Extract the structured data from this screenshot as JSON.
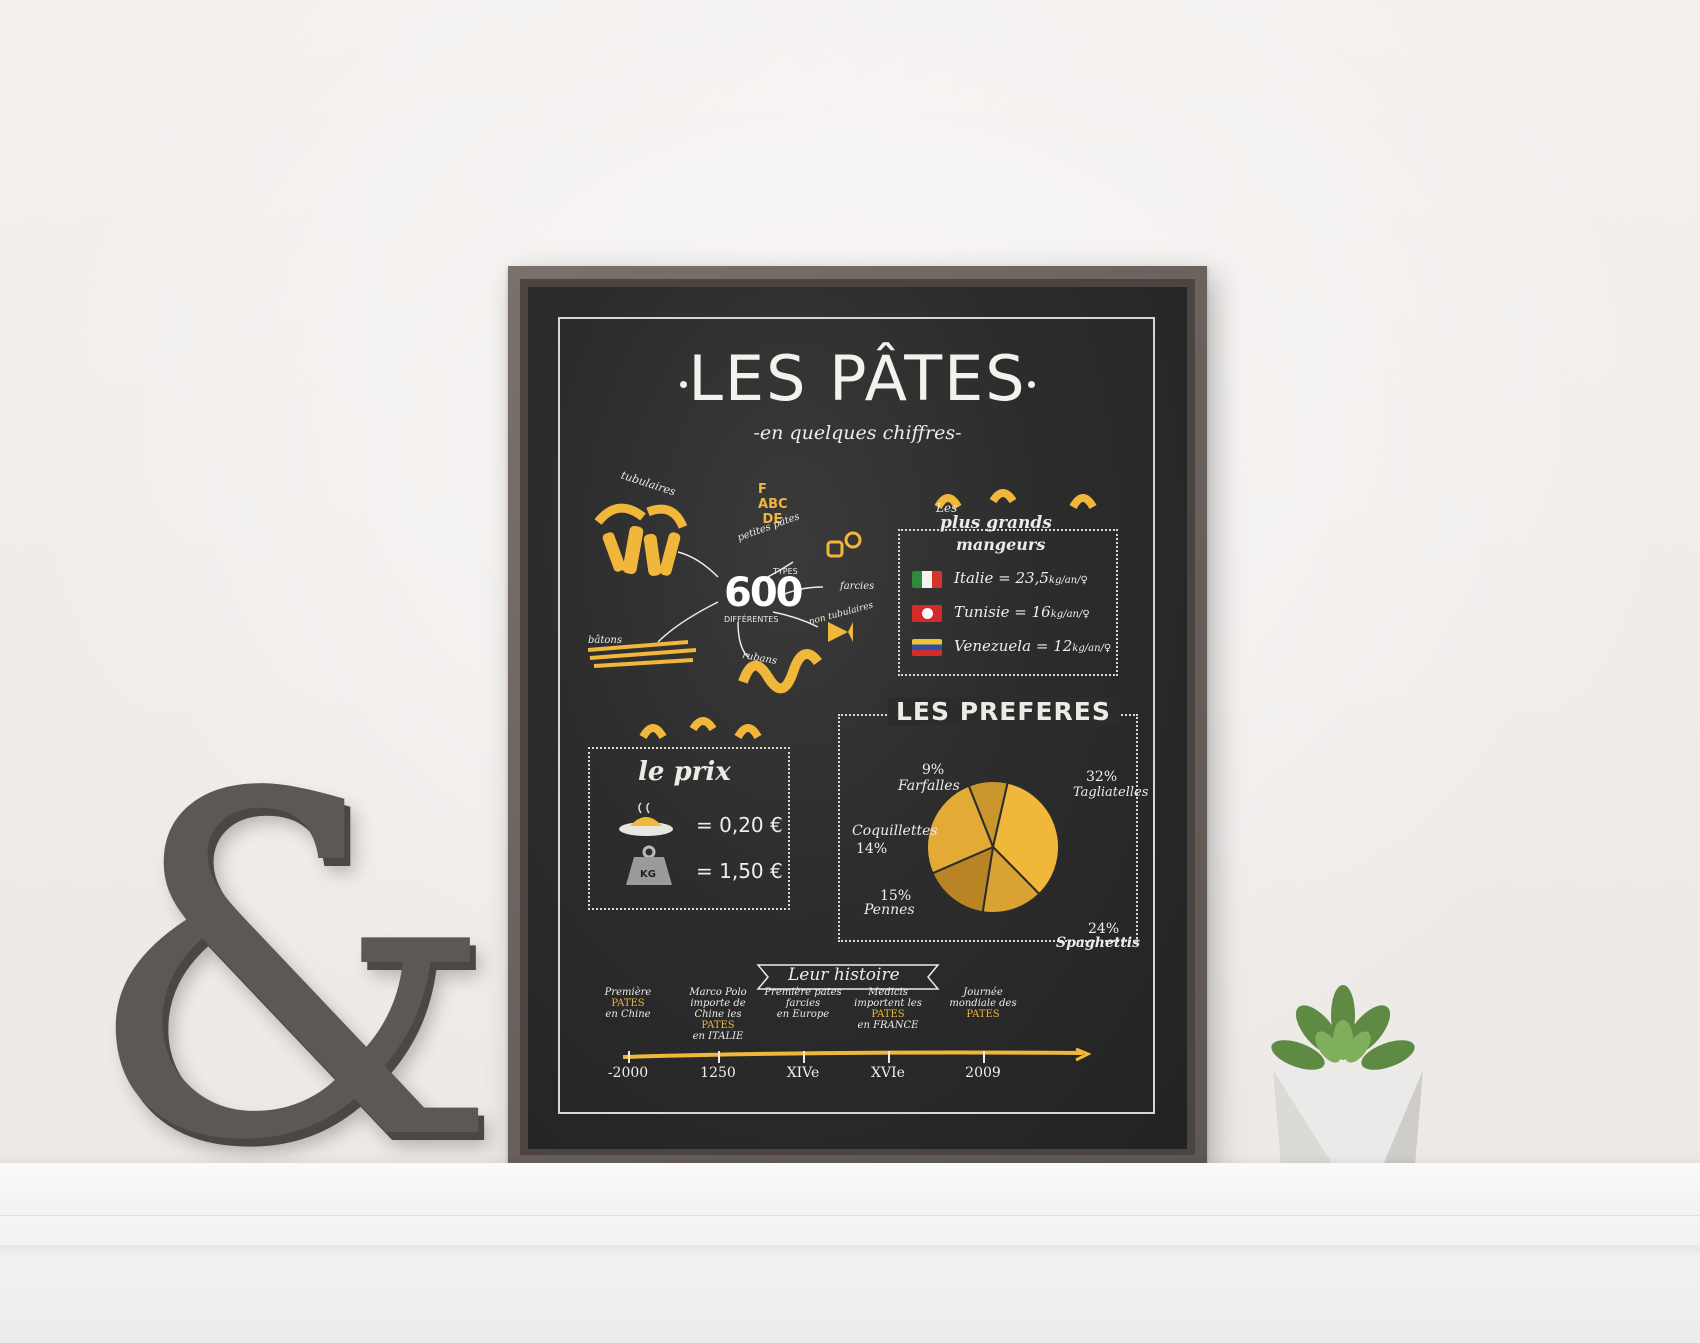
{
  "poster": {
    "title": "LES PÂTES",
    "subtitle": "-en quelques chiffres-",
    "types": {
      "count": "600",
      "top_label": "TYPES",
      "bottom_label": "DIFFÉRENTES",
      "categories": [
        "tubulaires",
        "petites pâtes",
        "farcies",
        "non tubulaires",
        "rubans",
        "bâtons"
      ],
      "letters": [
        "F",
        "A",
        "B",
        "C",
        "D",
        "E"
      ]
    },
    "eaters": {
      "heading_line1": "Les",
      "heading_line2": "plus grands",
      "heading_line3": "mangeurs",
      "rows": [
        {
          "country": "Italie",
          "eq": "=",
          "value": "23,5",
          "unit": "kg/an/♀",
          "colors": [
            "#2e8b3e",
            "#f3f3f0",
            "#d6332d"
          ]
        },
        {
          "country": "Tunisie",
          "eq": "=",
          "value": "16",
          "unit": "kg/an/♀",
          "colors": [
            "#d32a2a",
            "#d32a2a",
            "#d32a2a"
          ]
        },
        {
          "country": "Venezuela",
          "eq": "=",
          "value": "12",
          "unit": "kg/an/♀",
          "colors": [
            "#f2c230",
            "#2a4fa8",
            "#d32a2a"
          ]
        }
      ]
    },
    "price": {
      "heading": "le prix",
      "plate_value": "= 0,20 €",
      "kg_label": "KG",
      "kg_value": "= 1,50 €"
    },
    "favorites": {
      "heading": "LES PREFERES",
      "items": [
        {
          "name": "Farfalles",
          "pct": "9%",
          "value": 9
        },
        {
          "name": "Tagliatelles",
          "pct": "32%",
          "value": 32
        },
        {
          "name": "Coquillettes",
          "pct": "14%",
          "value": 14
        },
        {
          "name": "Pennes",
          "pct": "15%",
          "value": 15
        },
        {
          "name": "Spaghettis",
          "pct": "24%",
          "value": 24
        }
      ]
    },
    "history": {
      "heading": "Leur histoire",
      "events": [
        {
          "text_a": "Première",
          "highlight": "PATES",
          "text_b": "en Chine",
          "date": "-2000"
        },
        {
          "text_a": "Marco Polo importe de Chine les",
          "highlight": "PATES",
          "text_b": "en ITALIE",
          "date": "1250"
        },
        {
          "text_a": "Première pates farcies",
          "highlight": "",
          "text_b": "en Europe",
          "date": "XIVe"
        },
        {
          "text_a": "Medicis importent les",
          "highlight": "PATES",
          "text_b": "en FRANCE",
          "date": "XVIe"
        },
        {
          "text_a": "Journée mondiale des",
          "highlight": "PATES",
          "text_b": "",
          "date": "2009"
        }
      ]
    }
  },
  "colors": {
    "chalkboard": "#2c2c2c",
    "chalk": "#f2f0ea",
    "pasta_yellow": "#f0b73a",
    "frame": "#6b625e",
    "wall": "#f0ecea"
  },
  "decor": {
    "ampersand": "&",
    "plant": "succulent-plant-icon"
  }
}
